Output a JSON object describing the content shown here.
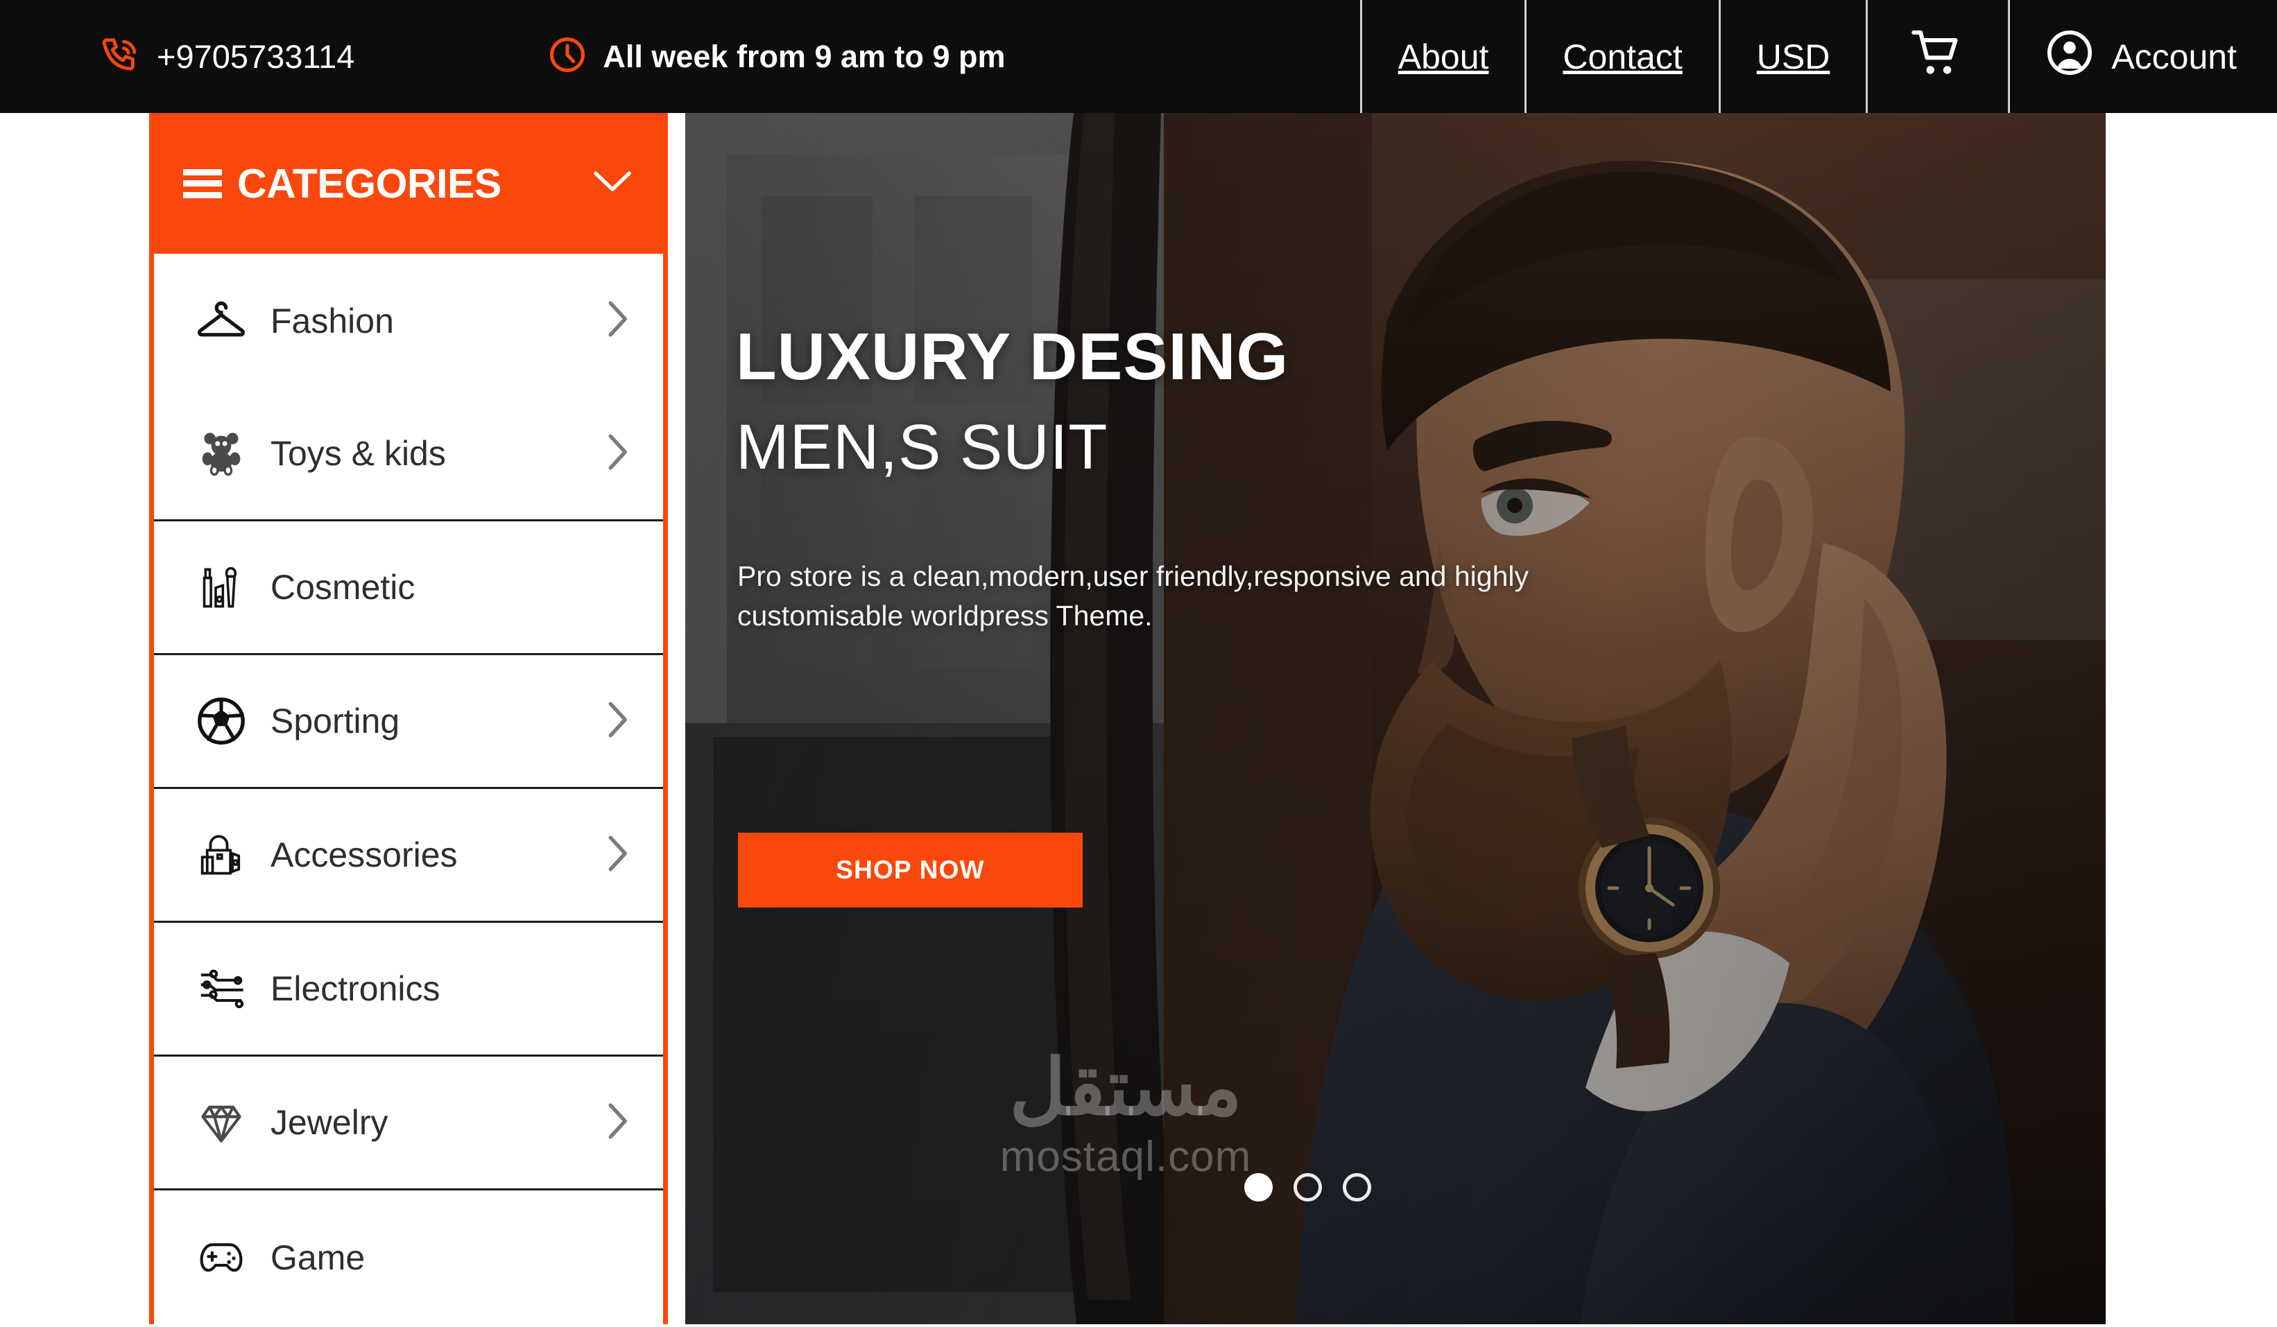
{
  "topbar": {
    "phone": "+9705733114",
    "hours": "All week from 9 am to 9 pm",
    "nav": [
      {
        "label": "About"
      },
      {
        "label": "Contact"
      },
      {
        "label": "USD"
      }
    ],
    "cart_label": "",
    "account_label": "Account",
    "icons": {
      "phone": "phone-ring-icon",
      "clock": "clock-icon",
      "cart": "shopping-cart-icon",
      "account": "user-account-icon"
    },
    "background_color": "#0d0d0d",
    "text_color": "#ffffff"
  },
  "sidebar": {
    "title": "CATEGORIES",
    "menu_icon": "hamburger-icon",
    "chevron_icon": "chevron-down-icon",
    "accent_color": "#F9480C",
    "items": [
      {
        "label": "Fashion",
        "icon": "clothes-hanger-icon",
        "has_arrow": true,
        "separator": false
      },
      {
        "label": "Toys & kids",
        "icon": "teddy-bear-icon",
        "has_arrow": true,
        "separator": true
      },
      {
        "label": "Cosmetic",
        "icon": "makeup-icon",
        "has_arrow": false,
        "separator": true
      },
      {
        "label": "Sporting",
        "icon": "soccer-ball-icon",
        "has_arrow": true,
        "separator": true
      },
      {
        "label": "Accessories",
        "icon": "handbag-icon",
        "has_arrow": true,
        "separator": true
      },
      {
        "label": "Electronics",
        "icon": "circuit-icon",
        "has_arrow": false,
        "separator": true
      },
      {
        "label": "Jewelry",
        "icon": "diamond-icon",
        "has_arrow": true,
        "separator": true
      },
      {
        "label": "Game",
        "icon": "gamepad-icon",
        "has_arrow": false,
        "separator": false
      }
    ]
  },
  "hero": {
    "headline": "LUXURY DESING",
    "subheadline": "MEN,S SUIT",
    "paragraph": "Pro store is a clean,modern,user friendly,responsive and highly customisable worldpress Theme.",
    "cta_label": "SHOP NOW",
    "cta_color": "#F9480C",
    "slides": [
      {
        "active": true
      },
      {
        "active": false
      },
      {
        "active": false
      }
    ],
    "watermark_arabic": "مستقل",
    "watermark_latin": "mostaql.com"
  }
}
